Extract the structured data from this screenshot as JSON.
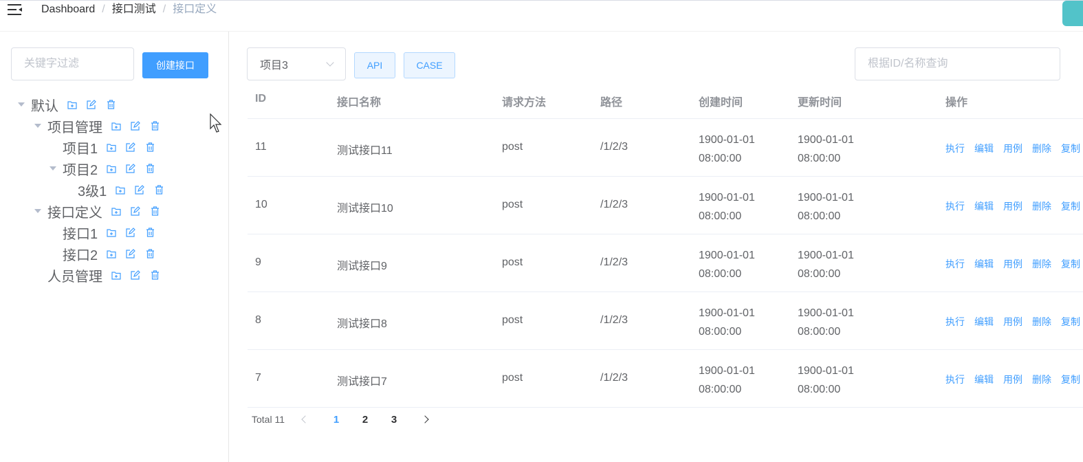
{
  "breadcrumb": [
    "Dashboard",
    "接口测试",
    "接口定义"
  ],
  "left": {
    "filter_placeholder": "关键字过滤",
    "create_label": "创建接口",
    "tree": [
      {
        "label": "默认",
        "expanded": true
      },
      {
        "label": "项目管理",
        "expanded": true
      },
      {
        "label": "项目1",
        "expanded": false
      },
      {
        "label": "项目2",
        "expanded": true
      },
      {
        "label": "3级1",
        "expanded": false
      },
      {
        "label": "接口定义",
        "expanded": true
      },
      {
        "label": "接口1",
        "expanded": false
      },
      {
        "label": "接口2",
        "expanded": false
      },
      {
        "label": "人员管理",
        "expanded": false
      }
    ]
  },
  "toolbar": {
    "project_value": "项目3",
    "api_label": "API",
    "case_label": "CASE",
    "search_placeholder": "根据ID/名称查询"
  },
  "table": {
    "headers": [
      "ID",
      "接口名称",
      "请求方法",
      "路径",
      "创建时间",
      "更新时间",
      "操作"
    ],
    "rows": [
      {
        "id": "11",
        "name": "测试接口11",
        "method": "post",
        "path": "/1/2/3",
        "created": "1900-01-01 08:00:00",
        "updated": "1900-01-01 08:00:00"
      },
      {
        "id": "10",
        "name": "测试接口10",
        "method": "post",
        "path": "/1/2/3",
        "created": "1900-01-01 08:00:00",
        "updated": "1900-01-01 08:00:00"
      },
      {
        "id": "9",
        "name": "测试接口9",
        "method": "post",
        "path": "/1/2/3",
        "created": "1900-01-01 08:00:00",
        "updated": "1900-01-01 08:00:00"
      },
      {
        "id": "8",
        "name": "测试接口8",
        "method": "post",
        "path": "/1/2/3",
        "created": "1900-01-01 08:00:00",
        "updated": "1900-01-01 08:00:00"
      },
      {
        "id": "7",
        "name": "测试接口7",
        "method": "post",
        "path": "/1/2/3",
        "created": "1900-01-01 08:00:00",
        "updated": "1900-01-01 08:00:00"
      }
    ],
    "actions": [
      "执行",
      "编辑",
      "用例",
      "删除",
      "复制"
    ]
  },
  "pagination": {
    "total": "Total 11",
    "pages": [
      "1",
      "2",
      "3"
    ],
    "current": "1"
  },
  "colors": {
    "primary": "#409eff",
    "text": "#606266",
    "muted": "#909399"
  }
}
